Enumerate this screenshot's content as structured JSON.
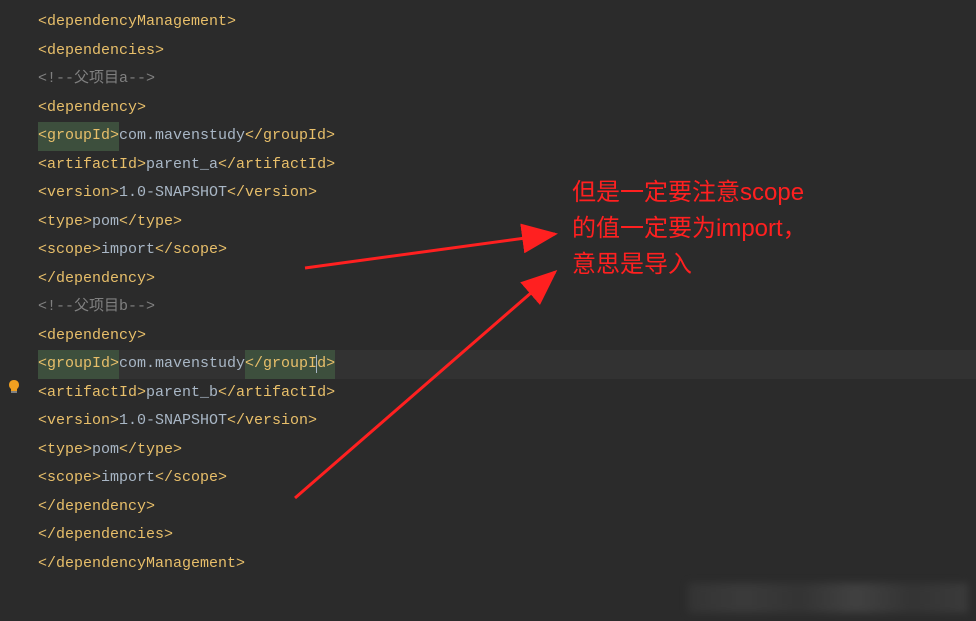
{
  "annotation": {
    "line1": "但是一定要注意scope",
    "line2": "的值一定要为import，",
    "line3": "意思是导入"
  },
  "code": {
    "l0_open": "<dependencyManagement>",
    "l1_open": "<dependencies>",
    "l2_comment": "<!--父项目a-->",
    "l3_open": "<dependency>",
    "l4_groupId_open": "<groupId>",
    "l4_groupId_val": "com.mavenstudy",
    "l4_groupId_close": "</groupId>",
    "l5_artifactId_open": "<artifactId>",
    "l5_artifactId_val": "parent_a",
    "l5_artifactId_close": "</artifactId>",
    "l6_version_open": "<version>",
    "l6_version_val": "1.0-SNAPSHOT",
    "l6_version_close": "</version>",
    "l7_type_open": "<type>",
    "l7_type_val": "pom",
    "l7_type_close": "</type>",
    "l8_scope_open": "<scope>",
    "l8_scope_val": "import",
    "l8_scope_close": "</scope>",
    "l9_close": "</dependency>",
    "l10_comment": "<!--父项目b-->",
    "l11_open": "<dependency>",
    "l12_groupId_open": "<groupId>",
    "l12_groupId_val": "com.mavenstudy",
    "l12_groupId_close_part1": "</groupI",
    "l12_groupId_close_part2": "d>",
    "l13_artifactId_open": "<artifactId>",
    "l13_artifactId_val": "parent_b",
    "l13_artifactId_close": "</artifactId>",
    "l14_version_open": "<version>",
    "l14_version_val": "1.0-SNAPSHOT",
    "l14_version_close": "</version>",
    "l15_type_open": "<type>",
    "l15_type_val": "pom",
    "l15_type_close": "</type>",
    "l16_scope_open": "<scope>",
    "l16_scope_val": "import",
    "l16_scope_close": "</scope>",
    "l17_close": "</dependency>",
    "l18_close": "</dependencies>",
    "l19_close": "</dependencyManagement>"
  }
}
